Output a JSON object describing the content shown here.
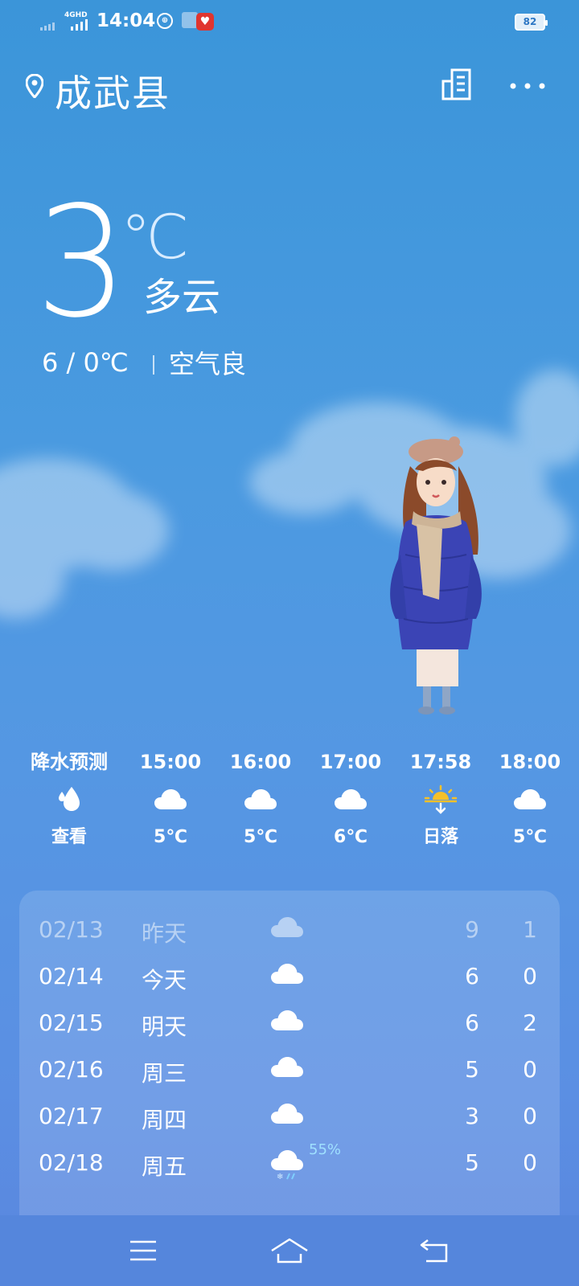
{
  "status_bar": {
    "network": "4GHD",
    "time": "14:04",
    "battery": "82",
    "dnd_glyph": "⊕"
  },
  "header": {
    "city": "成武县",
    "icons": {
      "location": "location-pin-icon",
      "city_list": "city-list-icon",
      "more": "more-dots-icon"
    }
  },
  "current": {
    "temp": "3",
    "unit": "℃",
    "condition": "多云",
    "range": "6 / 0℃",
    "air_quality": "空气良"
  },
  "hourly": [
    {
      "time": "降水预测",
      "icon": "raindrop-icon",
      "value": "查看"
    },
    {
      "time": "15:00",
      "icon": "cloud-icon",
      "value": "5℃"
    },
    {
      "time": "16:00",
      "icon": "cloud-icon",
      "value": "5℃"
    },
    {
      "time": "17:00",
      "icon": "cloud-icon",
      "value": "6℃"
    },
    {
      "time": "17:58",
      "icon": "sunset-icon",
      "value": "日落"
    },
    {
      "time": "18:00",
      "icon": "cloud-icon",
      "value": "5℃"
    }
  ],
  "daily": [
    {
      "date": "02/13",
      "day": "昨天",
      "icon": "cloud-icon",
      "precip": "",
      "high": "9",
      "low": "1"
    },
    {
      "date": "02/14",
      "day": "今天",
      "icon": "cloud-icon",
      "precip": "",
      "high": "6",
      "low": "0"
    },
    {
      "date": "02/15",
      "day": "明天",
      "icon": "cloud-icon",
      "precip": "",
      "high": "6",
      "low": "2"
    },
    {
      "date": "02/16",
      "day": "周三",
      "icon": "cloud-icon",
      "precip": "",
      "high": "5",
      "low": "0"
    },
    {
      "date": "02/17",
      "day": "周四",
      "icon": "cloud-icon",
      "precip": "",
      "high": "3",
      "low": "0"
    },
    {
      "date": "02/18",
      "day": "周五",
      "icon": "sleet-icon",
      "precip": "55%",
      "high": "5",
      "low": "0"
    }
  ],
  "navbar": {
    "icons": [
      "menu-icon",
      "home-icon",
      "back-icon"
    ]
  },
  "colors": {
    "background_top": "#3b95d9",
    "background_bottom": "#5a86de",
    "precip_text": "#9fe0ff",
    "sunset_yellow": "#f5c02a"
  }
}
